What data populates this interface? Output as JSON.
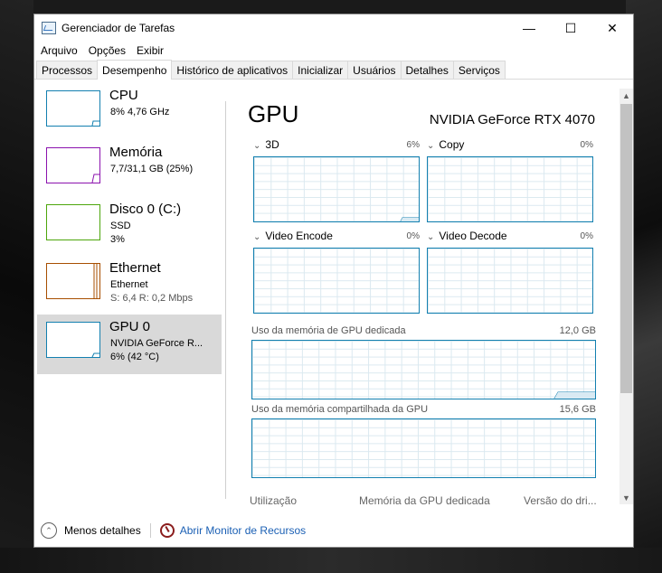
{
  "window": {
    "title": "Gerenciador de Tarefas",
    "controls": {
      "minimize": "—",
      "maximize": "☐",
      "close": "✕"
    }
  },
  "menu": [
    "Arquivo",
    "Opções",
    "Exibir"
  ],
  "tabs": [
    "Processos",
    "Desempenho",
    "Histórico de aplicativos",
    "Inicializar",
    "Usuários",
    "Detalhes",
    "Serviços"
  ],
  "active_tab": "Desempenho",
  "sidebar": {
    "items": [
      {
        "name": "CPU",
        "line1": "8% 4,76 GHz",
        "line2": "",
        "color": "#1380b0"
      },
      {
        "name": "Memória",
        "line1": "7,7/31,1 GB (25%)",
        "line2": "",
        "color": "#8b12ae"
      },
      {
        "name": "Disco 0 (C:)",
        "line1": "SSD",
        "line2": "3%",
        "color": "#4da60c"
      },
      {
        "name": "Ethernet",
        "line1": "Ethernet",
        "line2": "S: 6,4 R: 0,2 Mbps",
        "color": "#a74f01"
      },
      {
        "name": "GPU 0",
        "line1": "NVIDIA GeForce R...",
        "line2": "6% (42 °C)",
        "color": "#1380b0",
        "selected": true
      }
    ]
  },
  "gpu": {
    "title": "GPU",
    "model": "NVIDIA GeForce RTX 4070",
    "engines": [
      {
        "label": "3D",
        "pct": "6%",
        "utilization": 0.06
      },
      {
        "label": "Copy",
        "pct": "0%",
        "utilization": 0
      },
      {
        "label": "Video Encode",
        "pct": "0%",
        "utilization": 0
      },
      {
        "label": "Video Decode",
        "pct": "0%",
        "utilization": 0
      }
    ],
    "dedicated_mem": {
      "label": "Uso da memória de GPU dedicada",
      "max": "12,0 GB",
      "usage": 0.1
    },
    "shared_mem": {
      "label": "Uso da memória compartilhada da GPU",
      "max": "15,6 GB",
      "usage": 0
    },
    "columns": [
      "Utilização",
      "Memória da GPU dedicada",
      "Versão do dri..."
    ]
  },
  "footer": {
    "less_details": "Menos detalhes",
    "resource_monitor": "Abrir Monitor de Recursos"
  }
}
